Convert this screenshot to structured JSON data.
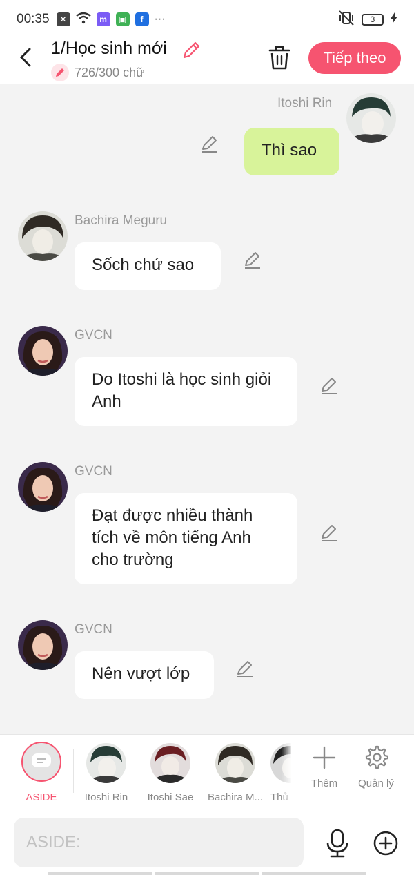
{
  "status_bar": {
    "time": "00:35",
    "battery": "3"
  },
  "header": {
    "title": "1/Học sinh mới",
    "word_count": "726/300 chữ",
    "next_label": "Tiếp theo",
    "accent_color": "#f65470"
  },
  "messages": [
    {
      "sender": "Itoshi Rin",
      "text": "Thì sao",
      "side": "right"
    },
    {
      "sender": "Bachira Meguru",
      "text": "Sốch chứ sao",
      "side": "left"
    },
    {
      "sender": "GVCN",
      "text": "Do Itoshi là học sinh giỏi Anh",
      "side": "left"
    },
    {
      "sender": "GVCN",
      "text": "Đạt được nhiều thành tích về môn tiếng Anh cho trường",
      "side": "left"
    },
    {
      "sender": "GVCN",
      "text": "Nên vượt lớp",
      "side": "left"
    }
  ],
  "character_tabs": [
    {
      "label": "ASIDE",
      "active": true
    },
    {
      "label": "Itoshi Rin"
    },
    {
      "label": "Itoshi Sae"
    },
    {
      "label": "Bachira M..."
    },
    {
      "label": "Thủ"
    }
  ],
  "actions": {
    "add_label": "Thêm",
    "manage_label": "Quản lý"
  },
  "input": {
    "placeholder": "ASIDE:"
  }
}
